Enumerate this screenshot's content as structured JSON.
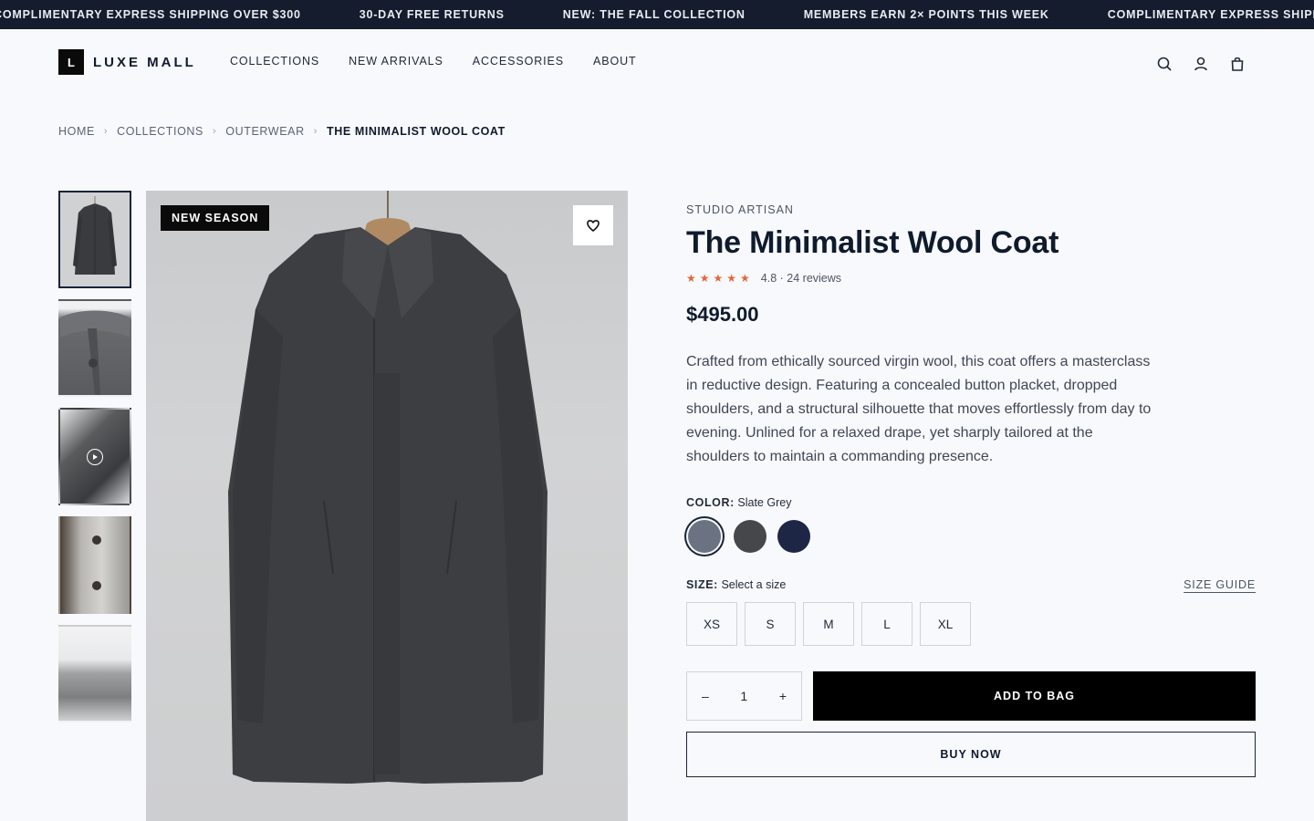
{
  "announcements": [
    "COMPLIMENTARY EXPRESS SHIPPING OVER $300",
    "30-DAY FREE RETURNS",
    "NEW: THE FALL COLLECTION",
    "MEMBERS EARN 2× POINTS THIS WEEK",
    "COMPLIMENTARY EXPRESS SHIPPING OVER $300"
  ],
  "logo": {
    "mark": "L",
    "text": "LUXE MALL"
  },
  "nav": [
    "COLLECTIONS",
    "NEW ARRIVALS",
    "ACCESSORIES",
    "ABOUT"
  ],
  "header_icons": [
    "search-icon",
    "account-icon",
    "bag-icon"
  ],
  "breadcrumb": [
    "HOME",
    "COLLECTIONS",
    "OUTERWEAR",
    "THE MINIMALIST WOOL COAT"
  ],
  "gallery": {
    "badge": "NEW SEASON",
    "thumbnails": [
      "coat-front",
      "collar-detail",
      "sleeve-video",
      "button-detail",
      "folded-coat"
    ]
  },
  "product": {
    "brand": "STUDIO ARTISAN",
    "title": "The Minimalist Wool Coat",
    "stars": "★★★★★",
    "rating": 4.8,
    "rating_text": "4.8 · 24 reviews",
    "price": "$495.00",
    "description": "Crafted from ethically sourced virgin wool, this coat offers a masterclass in reductive design. Featuring a concealed button placket, dropped shoulders, and a structural silhouette that moves effortlessly from day to evening. Unlined for a relaxed drape, yet sharply tailored at the shoulders to maintain a commanding presence.",
    "color_label": "COLOR:",
    "color_value": "Slate Grey",
    "colors": [
      {
        "name": "Slate Grey",
        "hex": "#6b7282",
        "selected": true
      },
      {
        "name": "Charcoal",
        "hex": "#45474b",
        "selected": false
      },
      {
        "name": "Navy",
        "hex": "#1d2745",
        "selected": false
      }
    ],
    "size_label": "SIZE:",
    "size_value": "Select a size",
    "size_guide": "SIZE GUIDE",
    "sizes": [
      "XS",
      "S",
      "M",
      "L",
      "XL"
    ],
    "qty_minus": "–",
    "quantity": "1",
    "qty_plus": "+",
    "add_to_bag": "ADD TO BAG",
    "buy_now": "BUY NOW"
  },
  "colors": {
    "topbar": "#141c2e",
    "text": "#0f1b2d",
    "star": "#e2673a",
    "background": "#f8f9fd"
  }
}
